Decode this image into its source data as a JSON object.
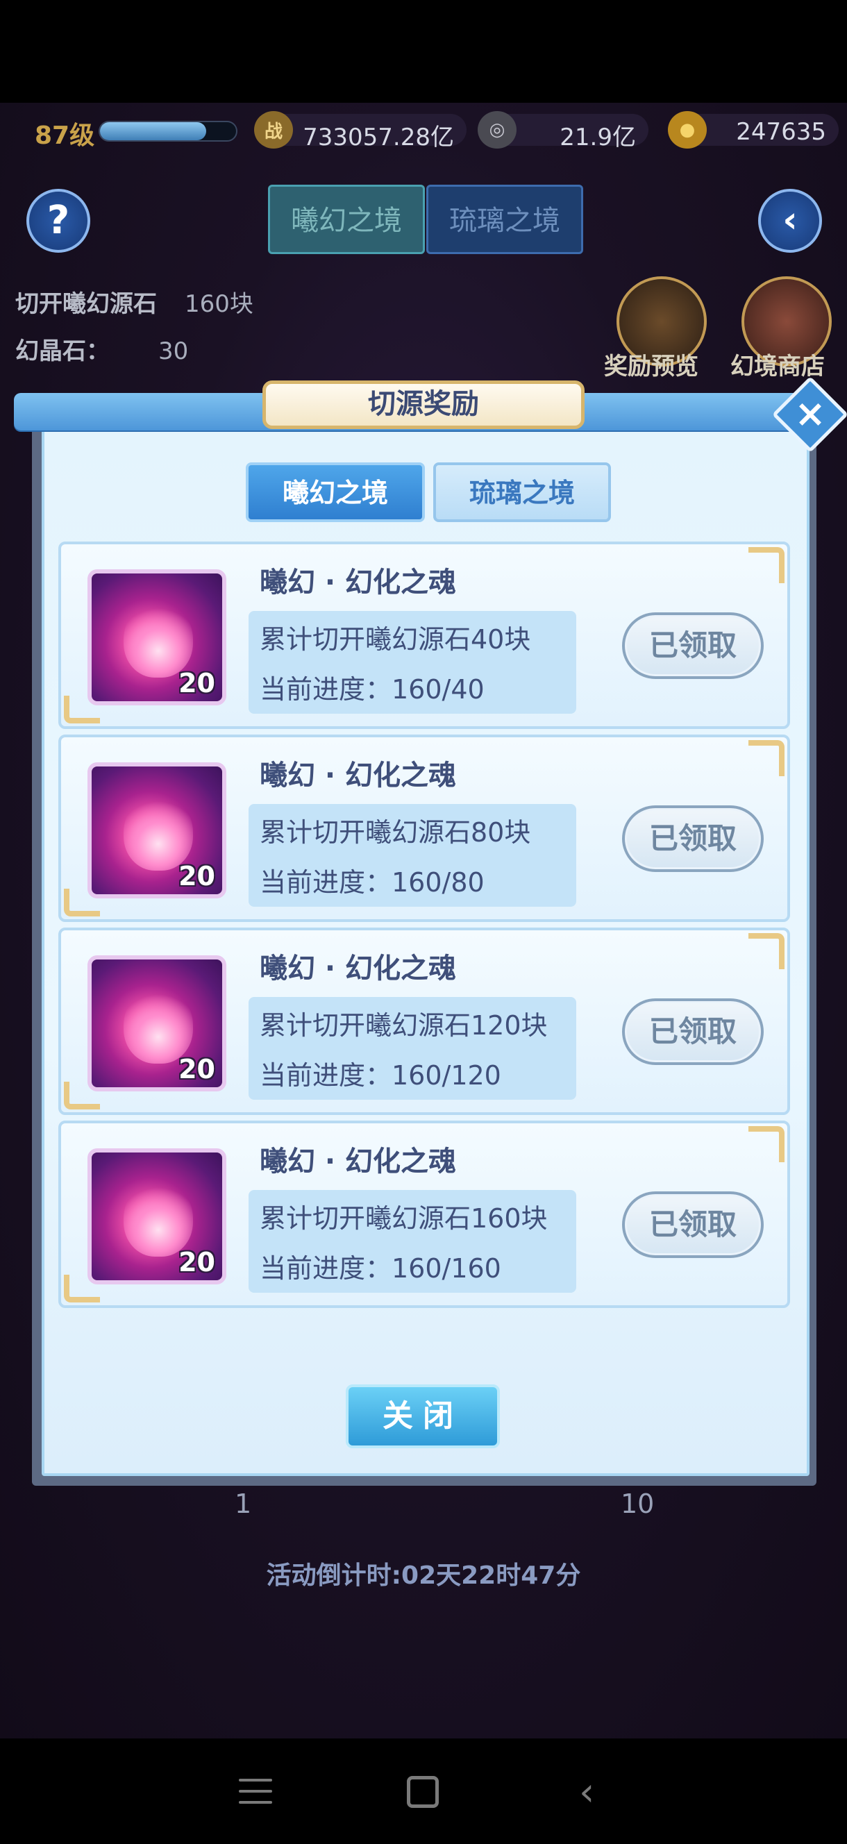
{
  "header": {
    "level": "87级",
    "exp_fraction": 0.78,
    "resources": [
      {
        "icon": "combat-power-icon",
        "glyph": "战",
        "value": "733057.28亿"
      },
      {
        "icon": "coin-icon",
        "glyph": "◎",
        "value": "21.9亿"
      },
      {
        "icon": "gold-ingot-icon",
        "glyph": "●",
        "value": "247635"
      }
    ]
  },
  "background": {
    "tabs": [
      "曦幻之境",
      "琉璃之境"
    ],
    "stats": [
      {
        "label": "切开曦幻源石",
        "value": "160块"
      },
      {
        "label": "幻晶石：",
        "value": "30"
      }
    ],
    "side_buttons": [
      "奖励预览",
      "幻境商店"
    ],
    "below_left": "1",
    "below_right": "10",
    "countdown": "活动倒计时:02天22时47分"
  },
  "dialog": {
    "title": "切源奖励",
    "tabs": [
      "曦幻之境",
      "琉璃之境"
    ],
    "rewards": [
      {
        "name": "曦幻 · 幻化之魂",
        "qty": "20",
        "requirement": "累计切开曦幻源石40块",
        "progress": "当前进度：160/40",
        "status": "已领取"
      },
      {
        "name": "曦幻 · 幻化之魂",
        "qty": "20",
        "requirement": "累计切开曦幻源石80块",
        "progress": "当前进度：160/80",
        "status": "已领取"
      },
      {
        "name": "曦幻 · 幻化之魂",
        "qty": "20",
        "requirement": "累计切开曦幻源石120块",
        "progress": "当前进度：160/120",
        "status": "已领取"
      },
      {
        "name": "曦幻 · 幻化之魂",
        "qty": "20",
        "requirement": "累计切开曦幻源石160块",
        "progress": "当前进度：160/160",
        "status": "已领取"
      }
    ],
    "close_label": "关闭"
  }
}
